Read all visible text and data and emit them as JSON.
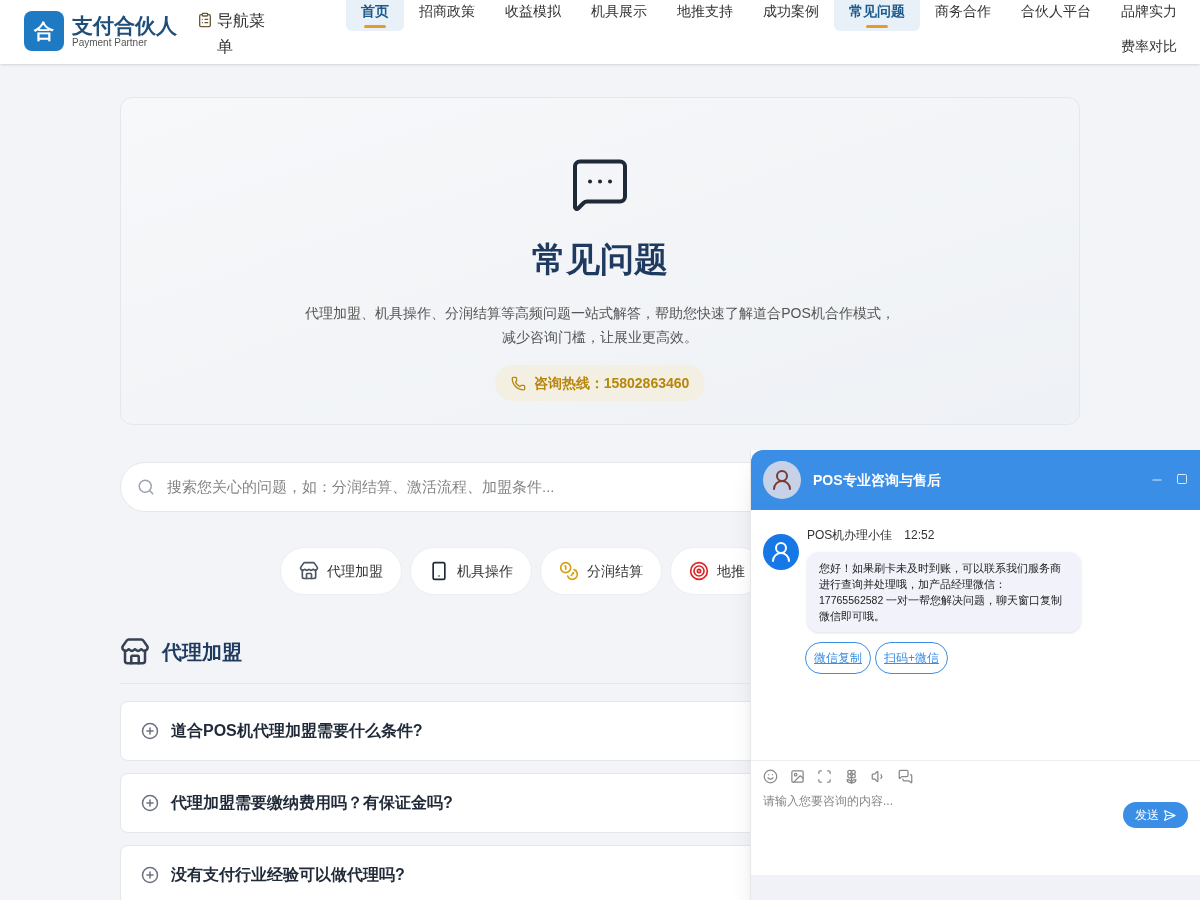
{
  "header": {
    "logo": {
      "mark": "合",
      "title": "支付合伙人",
      "subtitle": "Payment Partner"
    },
    "menu_label": "导航菜单",
    "nav": [
      {
        "label": "首页",
        "selected": true
      },
      {
        "label": "招商政策",
        "selected": false
      },
      {
        "label": "收益模拟",
        "selected": false
      },
      {
        "label": "机具展示",
        "selected": false
      },
      {
        "label": "地推支持",
        "selected": false
      },
      {
        "label": "成功案例",
        "selected": false
      },
      {
        "label": "常见问题",
        "selected": true
      },
      {
        "label": "商务合作",
        "selected": false
      },
      {
        "label": "合伙人平台",
        "selected": false
      },
      {
        "label": "品牌实力",
        "selected": false
      },
      {
        "label": "费率对比",
        "selected": false
      }
    ]
  },
  "hero": {
    "title": "常见问题",
    "description": "代理加盟、机具操作、分润结算等高频问题一站式解答，帮助您快速了解道合POS机合作模式，减少咨询门槛，让展业更高效。",
    "hotline": "咨询热线：15802863460"
  },
  "search": {
    "placeholder": "搜索您关心的问题，如：分润结算、激活流程、加盟条件..."
  },
  "categories": [
    {
      "label": "代理加盟"
    },
    {
      "label": "机具操作"
    },
    {
      "label": "分润结算"
    },
    {
      "label": "地推"
    }
  ],
  "section": {
    "title": "代理加盟",
    "questions": [
      {
        "text": "道合POS机代理加盟需要什么条件?",
        "expanded": false
      },
      {
        "text": "代理加盟需要缴纳费用吗？有保证金吗?",
        "expanded": false
      },
      {
        "text": "没有支付行业经验可以做代理吗?",
        "expanded": false
      }
    ]
  },
  "chat": {
    "title": "POS专业咨询与售后",
    "messages": [
      {
        "sender": "POS机办理小佳",
        "time": "12:52",
        "text": "您好！如果刷卡未及时到账，可以联系我们服务商进行查询并处理哦，加产品经理微信：17765562582 一对一帮您解决问题，聊天窗口复制微信即可哦。"
      }
    ],
    "actions": [
      "微信复制",
      "扫码+微信"
    ],
    "input": {
      "placeholder": "请输入您要咨询的内容..."
    },
    "send": "发送"
  }
}
